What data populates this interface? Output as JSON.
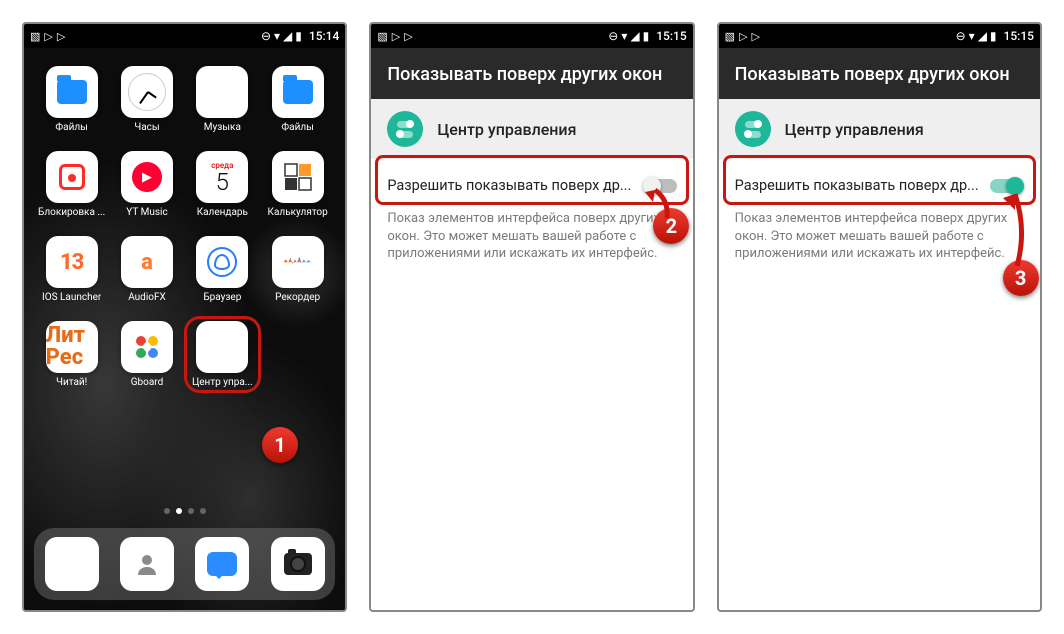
{
  "status": {
    "time1": "15:14",
    "time2": "15:15",
    "time3": "15:15"
  },
  "home": {
    "apps": [
      {
        "label": "Файлы"
      },
      {
        "label": "Часы"
      },
      {
        "label": "Музыка"
      },
      {
        "label": "Файлы"
      },
      {
        "label": "Блокировка ..."
      },
      {
        "label": "YT Music"
      },
      {
        "label": "Календарь",
        "cal_top": "среда",
        "cal_day": "5"
      },
      {
        "label": "Калькулятор"
      },
      {
        "label": "IOS Launcher",
        "ios": "13"
      },
      {
        "label": "AudioFX"
      },
      {
        "label": "Браузер"
      },
      {
        "label": "Рекордер"
      },
      {
        "label": "Читай!",
        "read": "Лит Рес"
      },
      {
        "label": "Gboard"
      },
      {
        "label": "Центр упра..."
      }
    ],
    "dock_names": [
      "phone",
      "contacts",
      "messages",
      "camera"
    ]
  },
  "settings": {
    "header": "Показывать поверх других окон",
    "app_name": "Центр управления",
    "permission_label": "Разрешить показывать поверх др...",
    "permission_desc": "Показ элементов интерфейса поверх других окон. Это может мешать вашей работе с приложениями или искажать их интерфейс."
  },
  "callouts": {
    "c1": "1",
    "c2": "2",
    "c3": "3"
  }
}
